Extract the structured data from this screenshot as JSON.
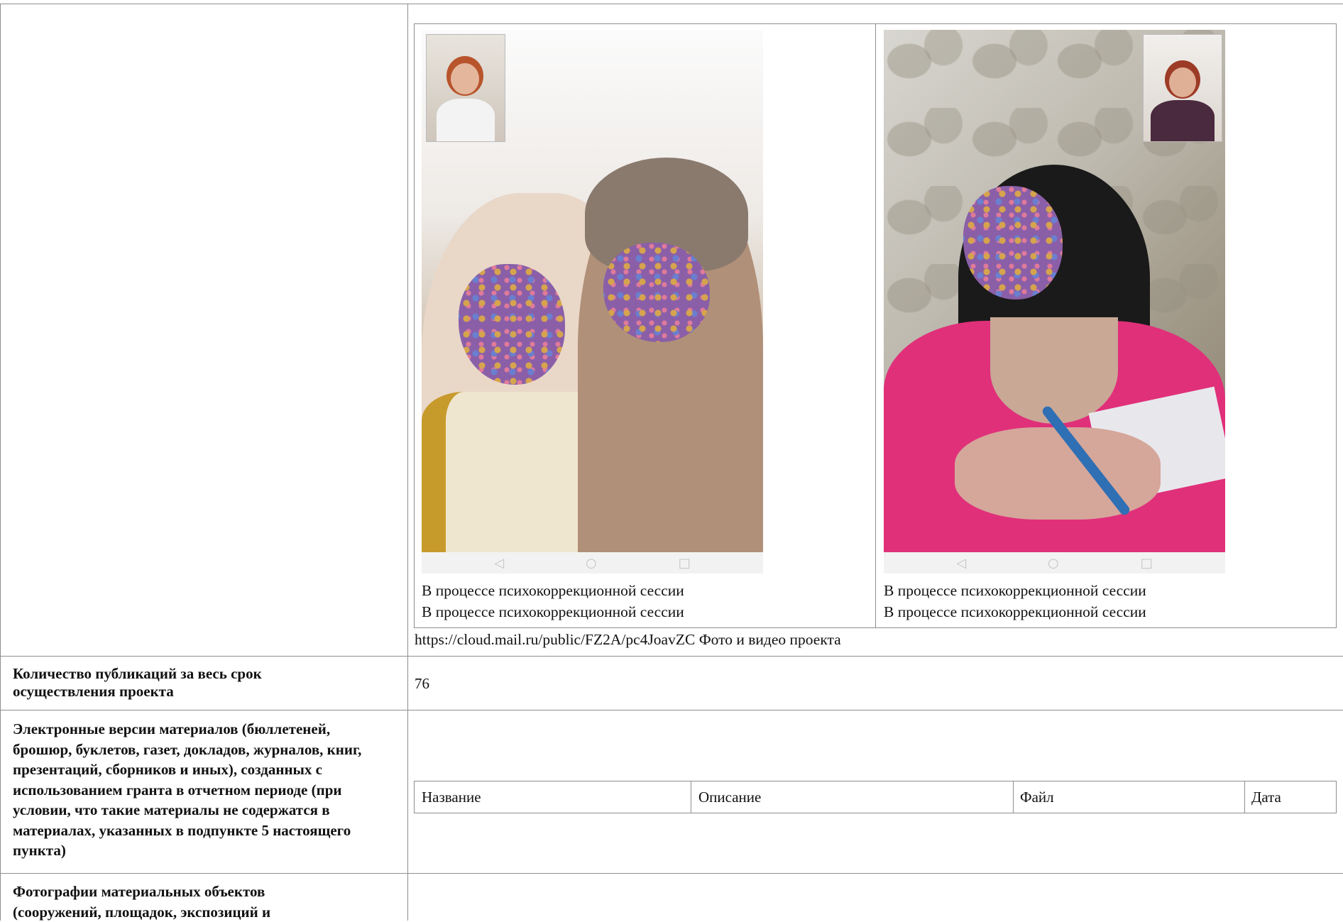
{
  "photos": {
    "left": {
      "caption_line1": "В процессе психокоррекционной сессии",
      "caption_line2": "В процессе психокоррекционной сессии"
    },
    "right": {
      "caption_line1": "В процессе психокоррекционной сессии",
      "caption_line2": "В процессе психокоррекционной сессии"
    },
    "nav_icons": [
      "back-triangle-icon",
      "home-circle-icon",
      "recent-square-icon"
    ],
    "link_text": "https://cloud.mail.ru/public/FZ2A/pc4JoavZC Фото и видео проекта"
  },
  "rows": {
    "publications": {
      "label": "Количество публикаций за весь срок осуществления проекта",
      "value": "76"
    },
    "materials": {
      "label": "Электронные версии материалов (бюллетеней, брошюр, буклетов, газет, докладов, журналов, книг, презентаций, сборников и иных), созданных с использованием гранта в отчетном периоде (при условии, что такие материалы не содержатся в материалах, указанных в подпункте 5 настоящего пункта)",
      "table_headers": [
        "Название",
        "Описание",
        "Файл",
        "Дата"
      ]
    },
    "photos_objects": {
      "label": "Фотографии материальных объектов (сооружений, площадок, экспозиций и"
    }
  }
}
